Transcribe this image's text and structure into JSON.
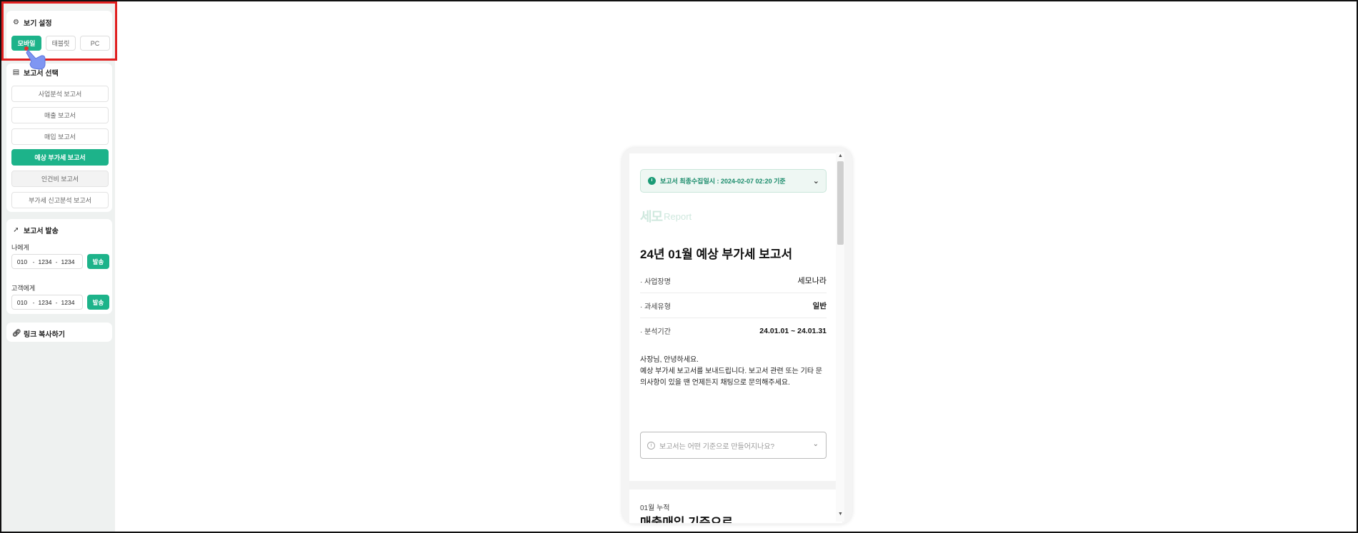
{
  "sidebar": {
    "view_settings": {
      "title": "보기 설정",
      "icon": "gear-icon",
      "buttons": [
        {
          "label": "모바일",
          "active": true
        },
        {
          "label": "태블릿",
          "active": false
        },
        {
          "label": "PC",
          "active": false
        }
      ]
    },
    "report_list": {
      "title": "보고서 선택",
      "icon": "document-icon",
      "items": [
        {
          "label": "사업분석 보고서"
        },
        {
          "label": "매출 보고서"
        },
        {
          "label": "매입 보고서"
        },
        {
          "label": "예상 부가세 보고서"
        },
        {
          "label": "인건비 보고서"
        },
        {
          "label": "부가세 신고분석 보고서"
        }
      ]
    },
    "send": {
      "title": "보고서 발송",
      "icon": "rocket-icon",
      "to_me_label": "나에게",
      "to_customer_label": "고객에게",
      "me_phone": [
        "010",
        "1234",
        "1234"
      ],
      "customer_phone": [
        "010",
        "1234",
        "1234"
      ],
      "send_label": "발송"
    },
    "link_copy": {
      "label": "링크 복사하기",
      "icon": "link-icon"
    }
  },
  "preview": {
    "banner": "보고서 최종수집일시 : 2024-02-07 02:20 기준",
    "logo_mark": "세모",
    "logo_text": "Report",
    "title": "24년 01월 예상 부가세 보고서",
    "rows": [
      {
        "key": "· 사업장명",
        "value": "세모나라"
      },
      {
        "key": "· 과세유형",
        "value": "일반"
      },
      {
        "key": "· 분석기간",
        "value": "24.01.01 ~ 24.01.31"
      }
    ],
    "greeting_1": "사장님, 안녕하세요.",
    "greeting_2": "예상 부가세 보고서를 보내드립니다. 보고서 관련 또는 기타 문의사항이 있을 땐 언제든지 채팅으로 문의해주세요.",
    "faq": "보고서는 어떤 기준으로 만들어지나요?",
    "section_sub": "01월 누적",
    "section_title": "매출매입 기준으로"
  }
}
